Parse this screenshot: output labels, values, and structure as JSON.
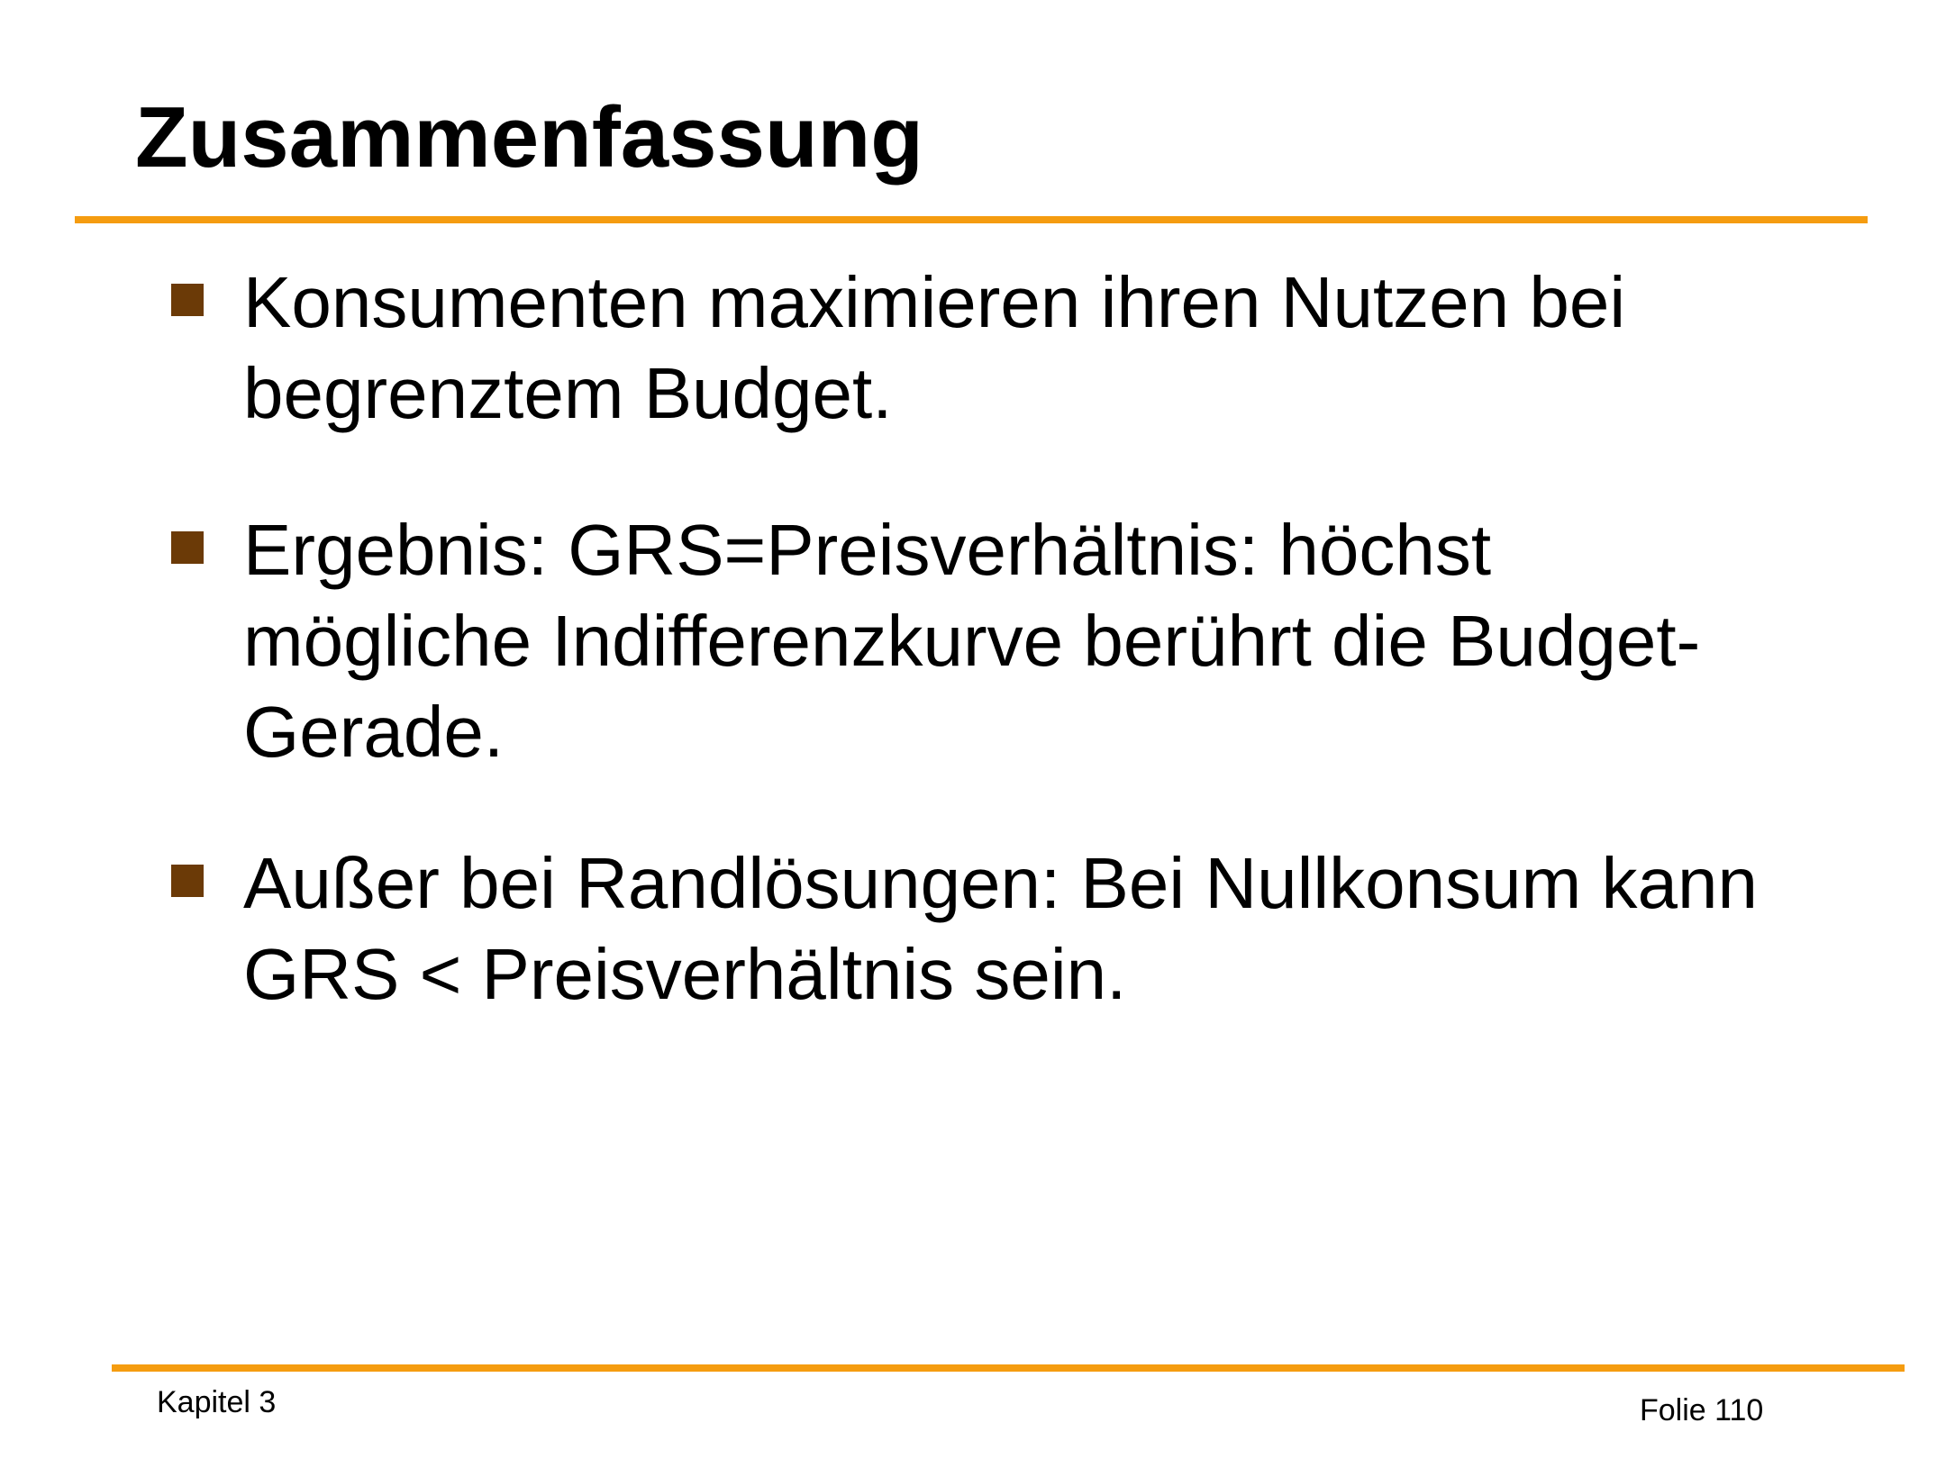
{
  "slide": {
    "title": "Zusammenfassung",
    "bullets": [
      {
        "lines": [
          "Konsumenten maximieren ihren Nutzen bei",
          "begrenztem Budget."
        ]
      },
      {
        "lines": [
          "Ergebnis: GRS=Preisverhältnis: höchst",
          "mögliche Indifferenzkurve berührt die Budget-",
          "Gerade."
        ]
      },
      {
        "lines": [
          "Außer bei Randlösungen: Bei Nullkonsum kann",
          "GRS < Preisverhältnis sein."
        ]
      }
    ],
    "footer": {
      "chapter": "Kapitel 3",
      "slide_number": "Folie 110"
    },
    "colors": {
      "accent_rule": "#f59c10",
      "bullet_marker": "#6b3a07",
      "text": "#000000",
      "background": "#ffffff"
    }
  }
}
